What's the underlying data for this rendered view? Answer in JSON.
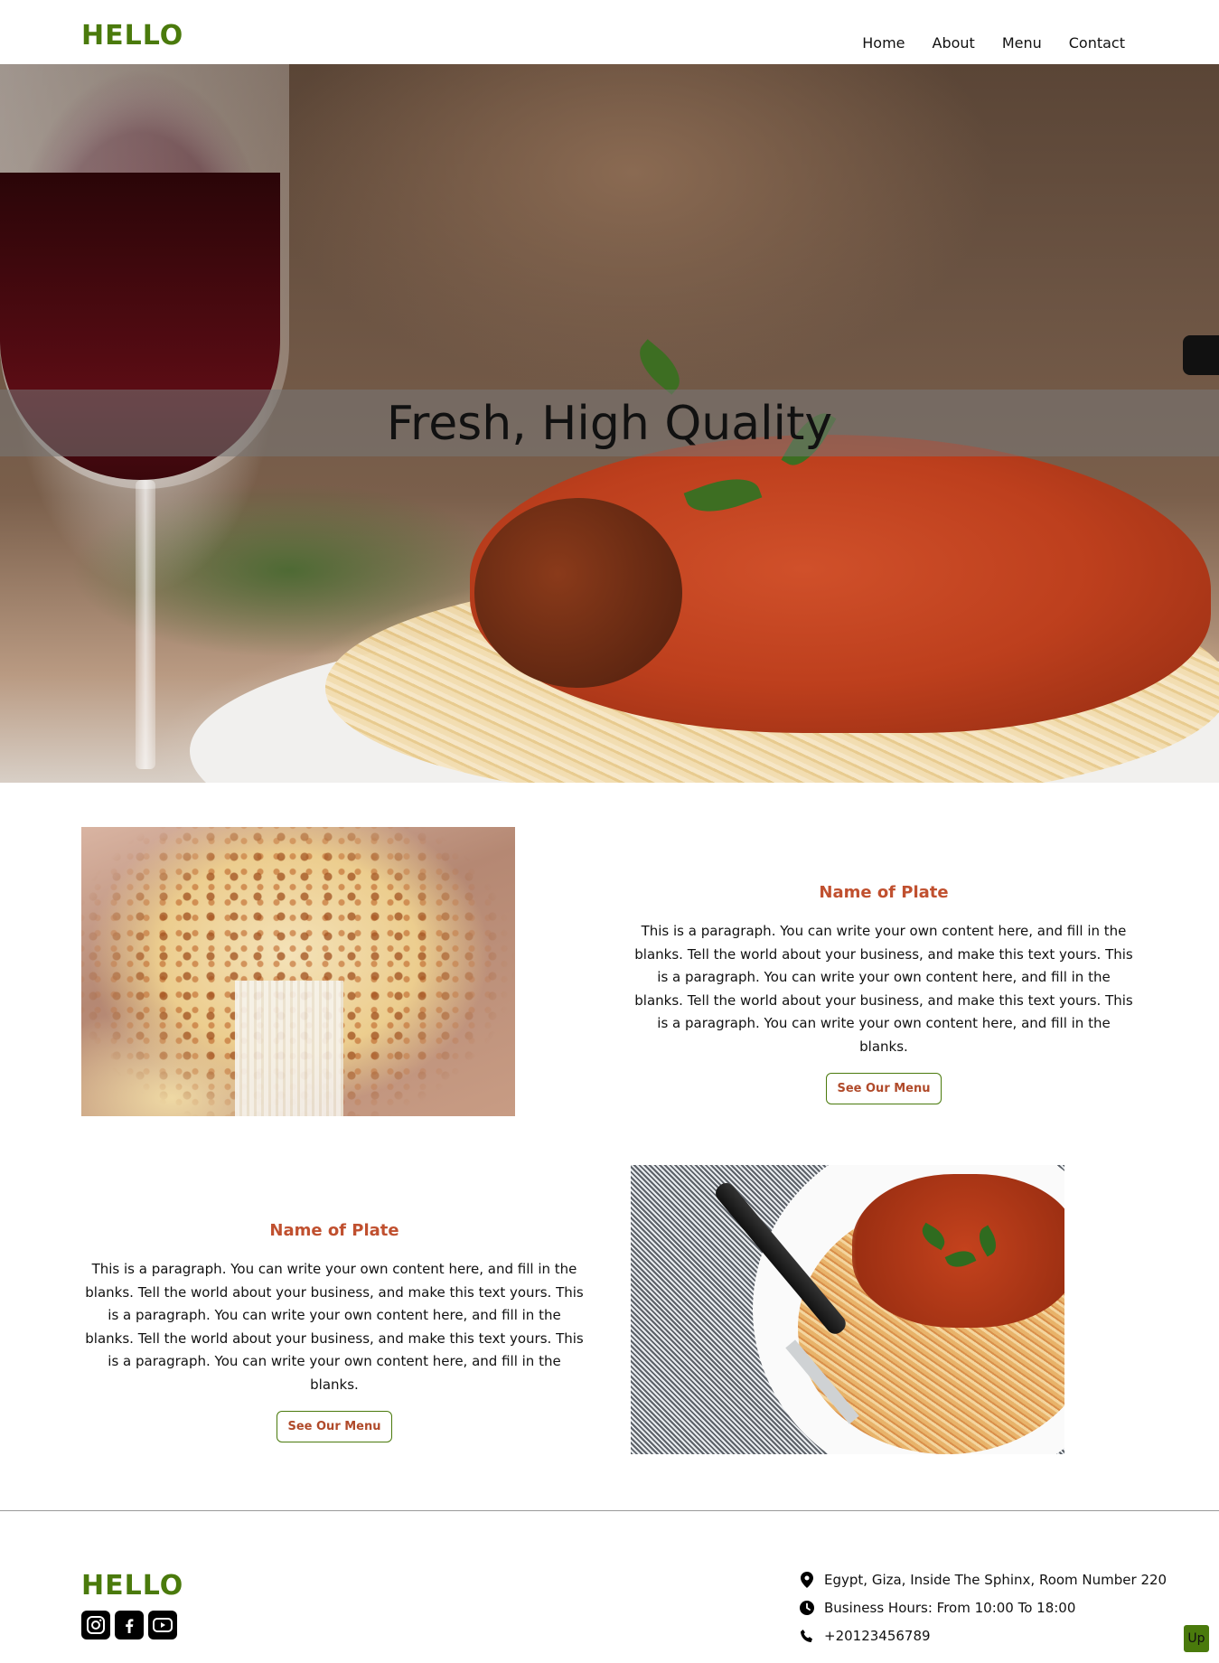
{
  "header": {
    "logo": "HELLO",
    "nav": [
      "Home",
      "About",
      "Menu",
      "Contact"
    ]
  },
  "hero": {
    "title": "Fresh, High Quality"
  },
  "features": [
    {
      "image": "pizza-slice-photo",
      "title": "Name of Plate",
      "paragraph": "This is a paragraph. You can write your own content here, and fill in the blanks. Tell the world about your business, and make this text yours. This is a paragraph. You can write your own content here, and fill in the blanks. Tell the world about your business, and make this text yours. This is a paragraph. You can write your own content here, and fill in the blanks.",
      "button": "See Our Menu"
    },
    {
      "image": "spaghetti-meatballs-photo",
      "title": "Name of Plate",
      "paragraph": "This is a paragraph. You can write your own content here, and fill in the blanks. Tell the world about your business, and make this text yours. This is a paragraph. You can write your own content here, and fill in the blanks. Tell the world about your business, and make this text yours. This is a paragraph. You can write your own content here, and fill in the blanks.",
      "button": "See Our Menu"
    }
  ],
  "footer": {
    "logo": "HELLO",
    "socials": [
      "instagram-icon",
      "facebook-icon",
      "youtube-icon"
    ],
    "contact": {
      "address": "Egypt, Giza, Inside The Sphinx, Room Number 220",
      "hours": "Business Hours: From 10:00 To 18:00",
      "phone": "+20123456789"
    },
    "up_label": "Up"
  },
  "colors": {
    "brand_green": "#4a7a0c",
    "accent_red": "#c0502f"
  }
}
